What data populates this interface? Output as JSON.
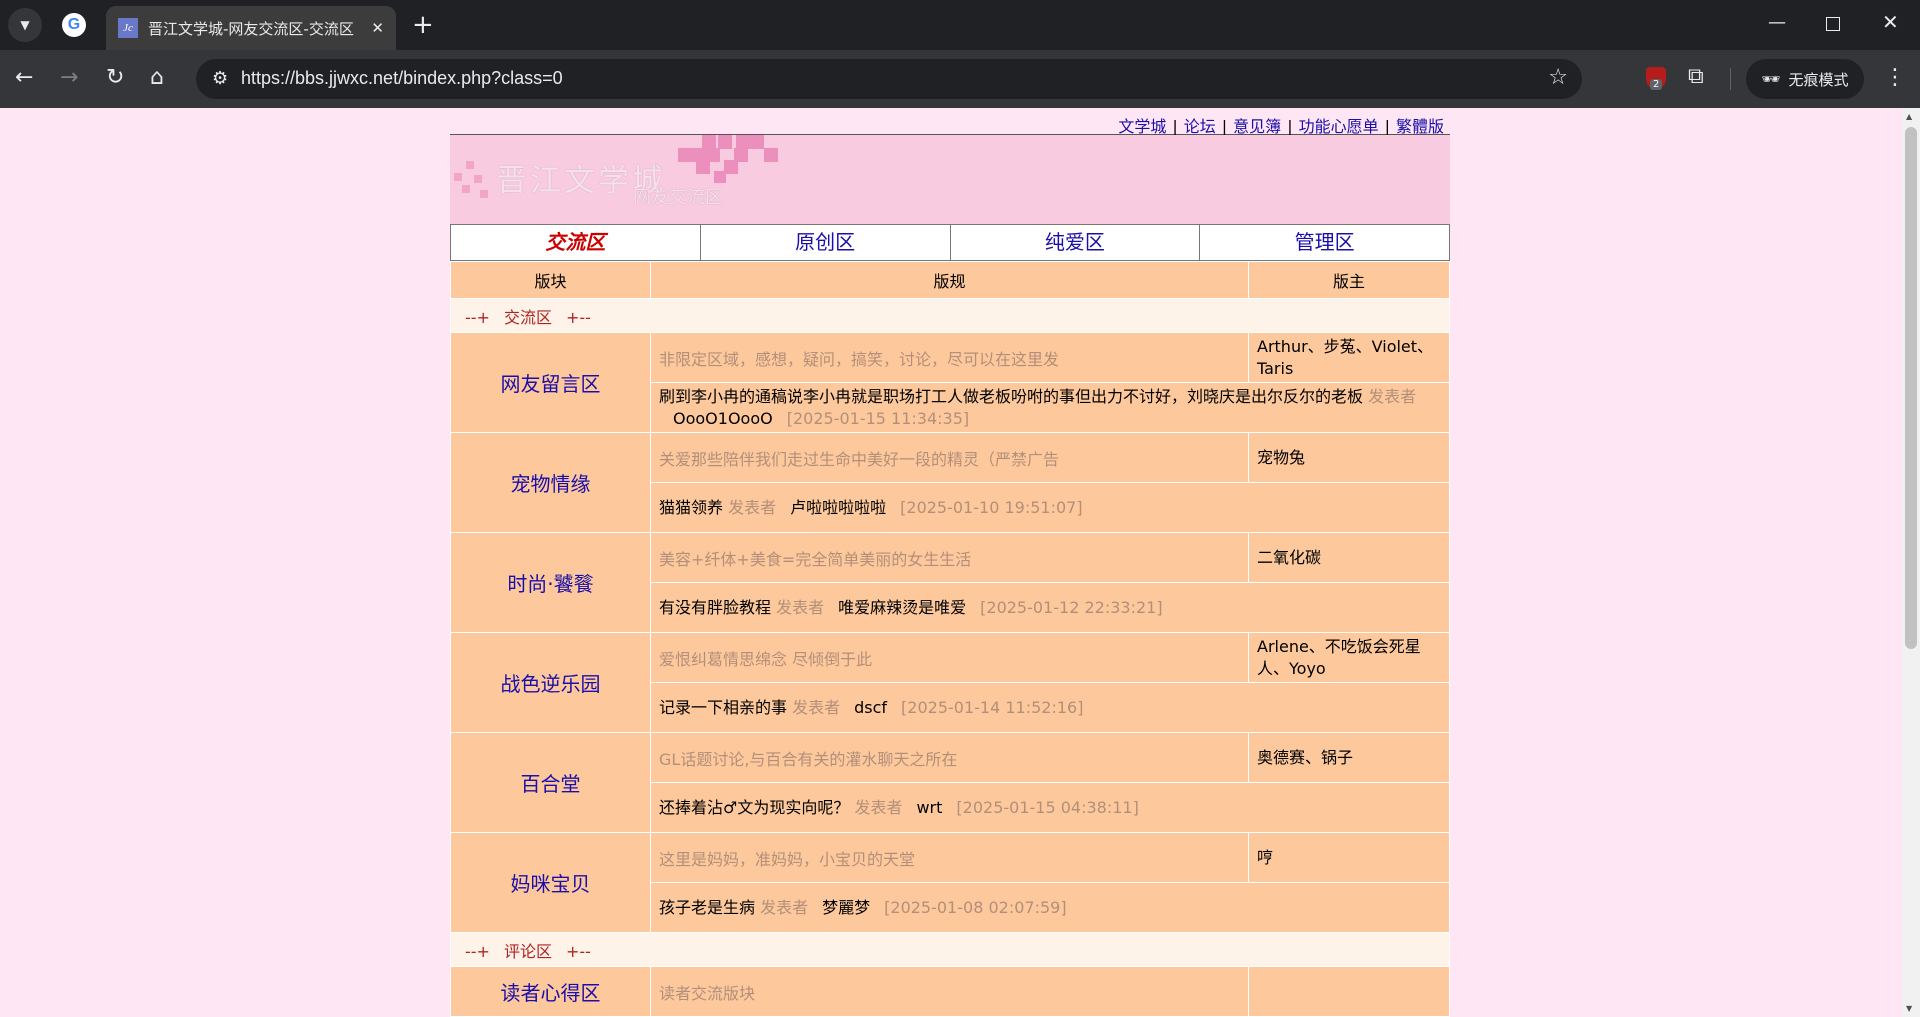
{
  "browser": {
    "tab_title": "晋江文学城-网友交流区-交流区",
    "url": "https://bbs.jjwxc.net/bindex.php?class=0",
    "incognito_label": "无痕模式",
    "extension_badge": "2",
    "favicon_text": "Jc"
  },
  "toplinks": [
    {
      "label": "文学城"
    },
    {
      "label": "论坛"
    },
    {
      "label": "意见簿"
    },
    {
      "label": "功能心愿单"
    },
    {
      "label": "繁體版"
    }
  ],
  "banner": {
    "title": "晋江文学城",
    "subtitle": "网友交流区"
  },
  "nav_tabs": [
    {
      "label": "交流区",
      "active": true
    },
    {
      "label": "原创区",
      "active": false
    },
    {
      "label": "纯爱区",
      "active": false
    },
    {
      "label": "管理区",
      "active": false
    }
  ],
  "table_headers": {
    "forum": "版块",
    "rules": "版规",
    "mods": "版主"
  },
  "sections": [
    {
      "prefix": "--+",
      "name": "交流区",
      "suffix": "+--",
      "forums": [
        {
          "name": "网友留言区",
          "rules": "非限定区域，感想，疑问，搞笑，讨论，尽可以在这里发",
          "mods": "Arthur、步菟、Violet、Taris",
          "latest_title": "刷到李小冉的通稿说李小冉就是职场打工人做老板吩咐的事但出力不讨好，刘晓庆是出尔反尔的老板",
          "by_label": "发表者",
          "author": "OooO1OooO",
          "date": "[2025-01-15 11:34:35]"
        },
        {
          "name": "宠物情缘",
          "rules": "关爱那些陪伴我们走过生命中美好一段的精灵（严禁广告",
          "mods": "宠物兔",
          "latest_title": "猫猫领养",
          "by_label": "发表者",
          "author": "卢啦啦啦啦啦",
          "date": "[2025-01-10 19:51:07]"
        },
        {
          "name": "时尚·饕餮",
          "rules": "美容+纤体+美食=完全简单美丽的女生生活",
          "mods": "二氧化碳",
          "latest_title": "有没有胖脸教程",
          "by_label": "发表者",
          "author": "唯爱麻辣烫是唯爱",
          "date": "[2025-01-12 22:33:21]"
        },
        {
          "name": "战色逆乐园",
          "rules": "爱恨纠葛情思绵念 尽倾倒于此",
          "mods": "Arlene、不吃饭会死星人、Yoyo",
          "latest_title": "记录一下相亲的事",
          "by_label": "发表者",
          "author": "dscf",
          "date": "[2025-01-14 11:52:16]"
        },
        {
          "name": "百合堂",
          "rules": "GL话题讨论,与百合有关的灌水聊天之所在",
          "mods": "奥德赛、锅子",
          "latest_title": "还捧着沾♂文为现实向呢？",
          "by_label": "发表者",
          "author": "wrt",
          "date": "[2025-01-15 04:38:11]"
        },
        {
          "name": "妈咪宝贝",
          "rules": "这里是妈妈，准妈妈，小宝贝的天堂",
          "mods": "哼",
          "latest_title": "孩子老是生病",
          "by_label": "发表者",
          "author": "梦麗梦",
          "date": "[2025-01-08 02:07:59]"
        }
      ]
    },
    {
      "prefix": "--+",
      "name": "评论区",
      "suffix": "+--",
      "forums": [
        {
          "name": "读者心得区",
          "rules": "读者交流版块",
          "mods": ""
        }
      ]
    }
  ]
}
